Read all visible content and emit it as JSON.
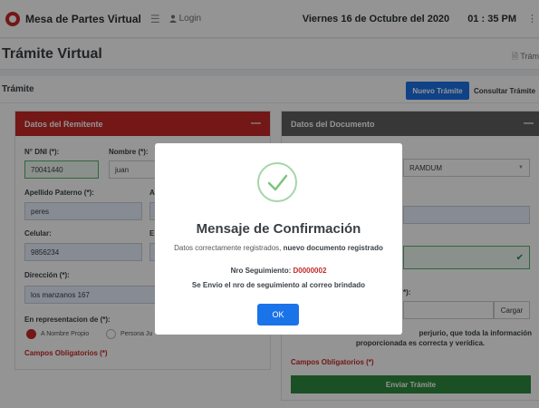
{
  "topbar": {
    "brand": "Mesa de Partes Virtual",
    "menu_icon": "hamburger-icon",
    "login_label": "Login",
    "date": "Viernes 16 de Octubre del 2020",
    "time": "01 : 35 PM"
  },
  "page": {
    "title": "Trámite Virtual",
    "breadcrumb": "Trám"
  },
  "tramite": {
    "header": "Trámite",
    "new_button": "Nuevo Trámite",
    "consult_button": "Consultar Trámite"
  },
  "remitente": {
    "title": "Datos del Remitente",
    "dni_label": "N° DNI (*):",
    "dni_value": "70041440",
    "nombre_label": "Nombre (*):",
    "nombre_value": "juan",
    "apellido_paterno_label": "Apellido Paterno (*):",
    "apellido_paterno_value": "peres",
    "apellido_materno_label": "A",
    "celular_label": "Celular:",
    "celular_value": "9856234",
    "email_label": "E",
    "direccion_label": "Dirección (*):",
    "direccion_value": "los manzanos 167",
    "representacion_label": "En representacion de (*):",
    "option_propio": "A Nombre Propio",
    "option_juridica": "Persona Ju",
    "required_note": "Campos Obligatorios (*)"
  },
  "documento": {
    "title": "Datos del Documento",
    "tipo_value": "RAMDUM",
    "file_label": "*):",
    "cargar_button": "Cargar",
    "declaracion_line1": "perjurio, que toda la información",
    "declaracion_line2": "proporcionada es correcta y verídica.",
    "required_note": "Campos Obligatorios (*)",
    "enviar_button": "Enviar Trámite"
  },
  "modal": {
    "title": "Mensaje de Confirmación",
    "msg_plain": "Datos correctamente registrados, ",
    "msg_bold": "nuevo documento registrado",
    "tracking_label": "Nro Seguimiento: ",
    "tracking_code": "D0000002",
    "note": "Se Envio el nro de seguimiento al correo brindado",
    "ok_button": "OK"
  },
  "colors": {
    "primary": "#1a73e8",
    "remitente_header": "#c62828",
    "documento_header": "#5f5f5f",
    "success": "#2e8b3e",
    "success_light": "#a5d6a7",
    "required": "#c62828"
  }
}
